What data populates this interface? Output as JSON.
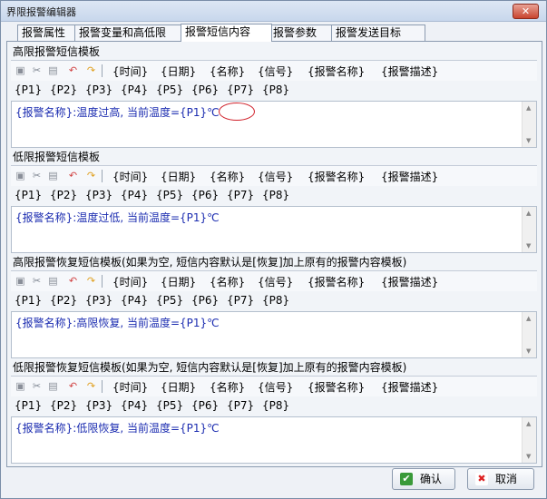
{
  "window": {
    "title": "界限报警编辑器",
    "close": "✕"
  },
  "tabs": [
    "报警属性",
    "报警变量和高低限",
    "报警短信内容",
    "报警参数",
    "报警发送目标"
  ],
  "active_tab": "报警短信内容",
  "tokens": [
    "{时间}",
    "{日期}",
    "{名称}",
    "{信号}",
    "{报警名称}",
    "{报警描述}"
  ],
  "ptokens": [
    "{P1}",
    "{P2}",
    "{P3}",
    "{P4}",
    "{P5}",
    "{P6}",
    "{P7}",
    "{P8}"
  ],
  "sections": [
    {
      "title": "高限报警短信模板",
      "content": "{报警名称}:温度过高, 当前温度={P1}℃"
    },
    {
      "title": "低限报警短信模板",
      "content": "{报警名称}:温度过低, 当前温度={P1}℃"
    },
    {
      "title": "高限报警恢复短信模板(如果为空, 短信内容默认是[恢复]加上原有的报警内容模板)",
      "content": "{报警名称}:高限恢复, 当前温度={P1}℃"
    },
    {
      "title": "低限报警恢复短信模板(如果为空, 短信内容默认是[恢复]加上原有的报警内容模板)",
      "content": "{报警名称}:低限恢复, 当前温度={P1}℃"
    }
  ],
  "buttons": {
    "ok": "确认",
    "cancel": "取消"
  },
  "icons": [
    "copy-icon",
    "cut-icon",
    "paste-icon",
    "undo-icon",
    "redo-icon"
  ],
  "colors": {
    "editor_text": "#1b2cb0",
    "highlight_circle": "#d0202a"
  }
}
